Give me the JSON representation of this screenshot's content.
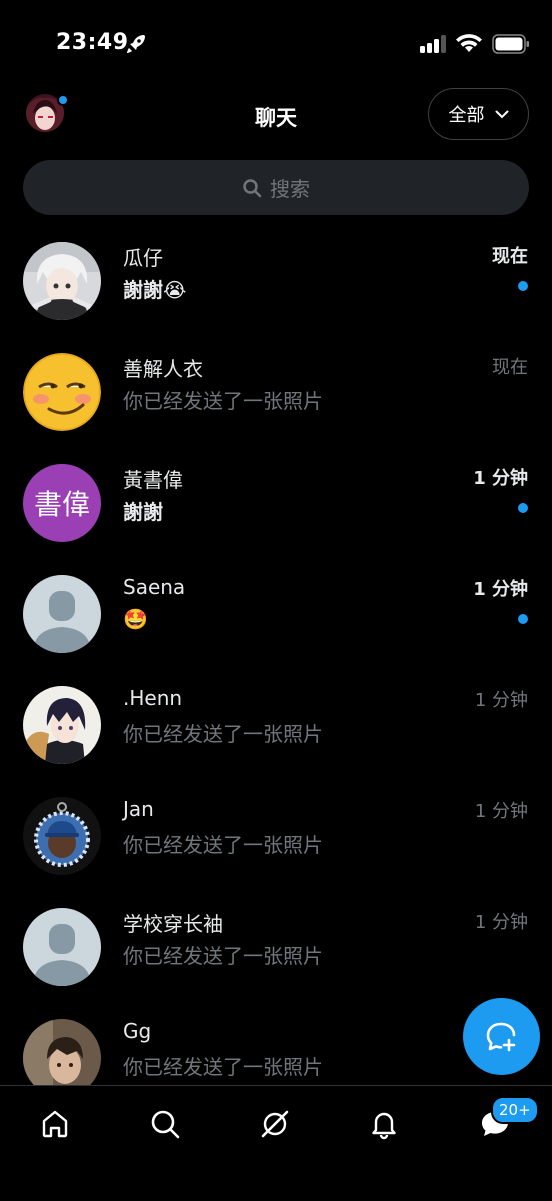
{
  "status_bar": {
    "time": "23:49"
  },
  "header": {
    "title": "聊天",
    "filter_label": "全部"
  },
  "search": {
    "placeholder": "搜索"
  },
  "chats": [
    {
      "name": "瓜仔",
      "preview": "謝謝😭",
      "time": "现在",
      "unread": true,
      "avatar": "anime-boy-white-hair"
    },
    {
      "name": "善解人衣",
      "preview": "你已经发送了一张照片",
      "time": "现在",
      "unread": false,
      "avatar": "smirk-emoji-face"
    },
    {
      "name": "黃書偉",
      "preview": "謝謝",
      "time": "1 分钟",
      "unread": true,
      "avatar": "initials",
      "initials": "書偉",
      "avatar_color": "#9b3fb5"
    },
    {
      "name": "Saena",
      "preview": "🤩",
      "time": "1 分钟",
      "unread": true,
      "avatar": "default-person"
    },
    {
      "name": ".Henn",
      "preview": "你已经发送了一张照片",
      "time": "1 分钟",
      "unread": false,
      "avatar": "anime-boy-dark-hair"
    },
    {
      "name": "Jan",
      "preview": "你已经发送了一张照片",
      "time": "1 分钟",
      "unread": false,
      "avatar": "photo-man-cap"
    },
    {
      "name": "学校穿长袖",
      "preview": "你已经发送了一张照片",
      "time": "1 分钟",
      "unread": false,
      "avatar": "default-person"
    },
    {
      "name": "Gg",
      "preview": "你已经发送了一张照片",
      "time": "",
      "unread": false,
      "avatar": "photo-person"
    }
  ],
  "bottom_nav": {
    "items": [
      "home-icon",
      "search-icon",
      "grok-icon",
      "bell-icon",
      "messages-icon"
    ],
    "messages_badge": "20+"
  },
  "colors": {
    "accent": "#1d9bf0",
    "background": "#000000",
    "muted": "#71767b"
  }
}
